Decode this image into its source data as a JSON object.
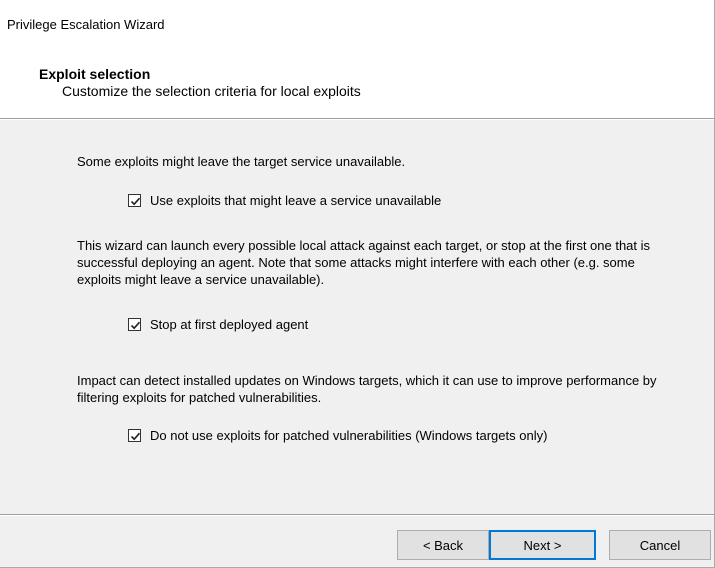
{
  "window": {
    "title": "Privilege Escalation Wizard"
  },
  "header": {
    "title": "Exploit selection",
    "subtitle": "Customize the selection criteria for local exploits"
  },
  "sections": [
    {
      "text": "Some exploits might leave the target service unavailable.",
      "checkbox": {
        "label": "Use exploits that might leave a service unavailable",
        "checked": true
      }
    },
    {
      "text": "This wizard can launch every possible local attack against each target, or stop at the first one that is successful deploying an agent. Note that some attacks might interfere with each other (e.g. some exploits might leave a service unavailable).",
      "checkbox": {
        "label": "Stop at first deployed agent",
        "checked": true
      }
    },
    {
      "text": "Impact can detect installed updates on Windows targets, which it can use to improve performance by filtering exploits for patched vulnerabilities.",
      "checkbox": {
        "label": "Do not use exploits for patched vulnerabilities (Windows targets only)",
        "checked": true
      }
    }
  ],
  "buttons": {
    "back": "< Back",
    "next": "Next >",
    "cancel": "Cancel"
  }
}
